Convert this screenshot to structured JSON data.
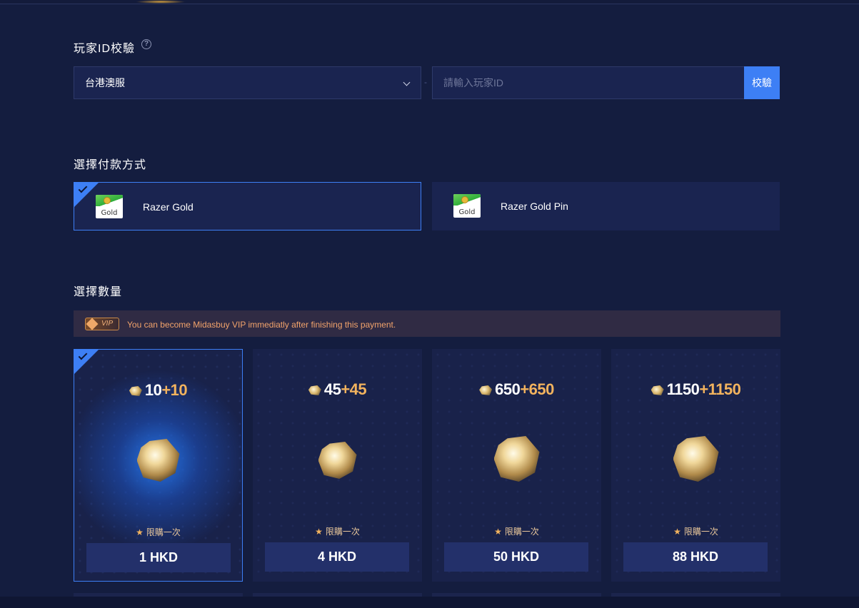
{
  "id_section": {
    "title": "玩家ID校驗",
    "help_icon": "question-circle-icon",
    "server_selected": "台港澳服",
    "id_placeholder": "請輸入玩家ID",
    "verify_label": "校驗"
  },
  "payment_section": {
    "title": "選擇付款方式",
    "methods": [
      {
        "label": "Razer Gold",
        "logo_text": "Gold",
        "selected": true
      },
      {
        "label": "Razer Gold Pin",
        "logo_text": "Gold",
        "selected": false
      }
    ]
  },
  "amount_section": {
    "title": "選擇數量",
    "vip_badge": "VIP",
    "vip_message": "You can become Midasbuy VIP immediatly after finishing this payment.",
    "packages": [
      {
        "base": "10",
        "bonus": "+10",
        "limit": "限購一次",
        "price": "1 HKD",
        "selected": true
      },
      {
        "base": "45",
        "bonus": "+45",
        "limit": "限購一次",
        "price": "4 HKD",
        "selected": false
      },
      {
        "base": "650",
        "bonus": "+650",
        "limit": "限購一次",
        "price": "50 HKD",
        "selected": false
      },
      {
        "base": "1150",
        "bonus": "+1150",
        "limit": "限購一次",
        "price": "88 HKD",
        "selected": false
      }
    ]
  },
  "colors": {
    "accent": "#3d7ff5",
    "background": "#141d3f",
    "bonus": "#f2b35e",
    "vip_text": "#f2a36b"
  }
}
